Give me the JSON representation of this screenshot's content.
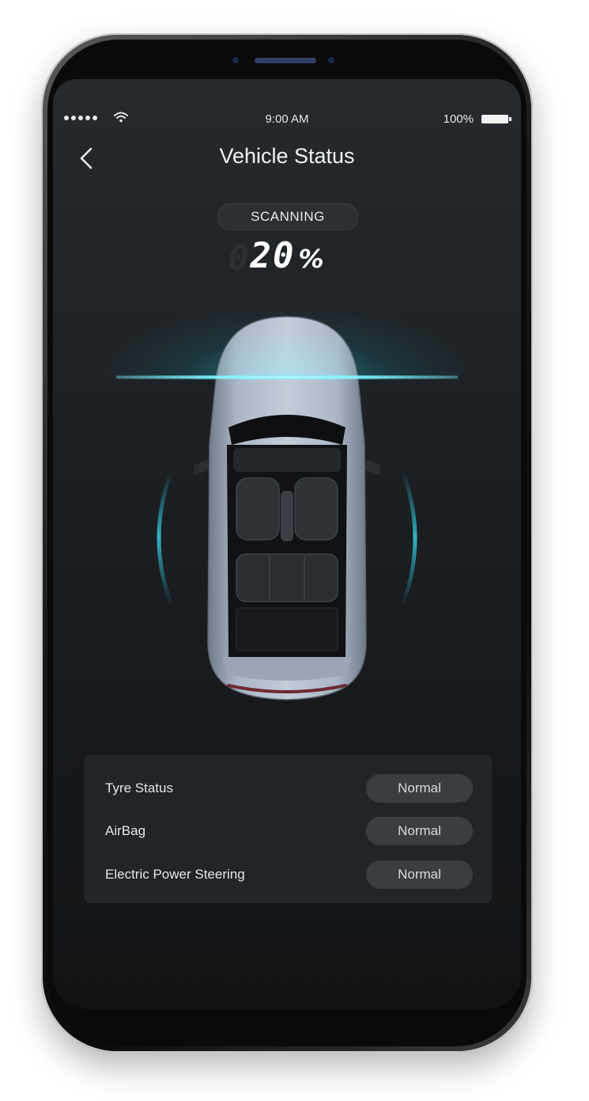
{
  "status_bar": {
    "time": "9:00 AM",
    "battery": "100%",
    "icons": [
      "signal-dots-icon",
      "wifi-icon",
      "battery-icon"
    ]
  },
  "header": {
    "title": "Vehicle Status",
    "back_icon": "chevron-left-icon"
  },
  "scan": {
    "label": "SCANNING",
    "value": "20",
    "unit": "%",
    "ghost_digit": "0",
    "progress": 0.2
  },
  "status_items": [
    {
      "label": "Tyre Status",
      "value": "Normal"
    },
    {
      "label": "AirBag",
      "value": "Normal"
    },
    {
      "label": "Electric Power Steering",
      "value": "Normal"
    }
  ],
  "colors": {
    "accent": "#39c8dc",
    "screen_bg": "#1d2125",
    "card_bg": "#222528",
    "badge_bg": "#3a3e43"
  }
}
